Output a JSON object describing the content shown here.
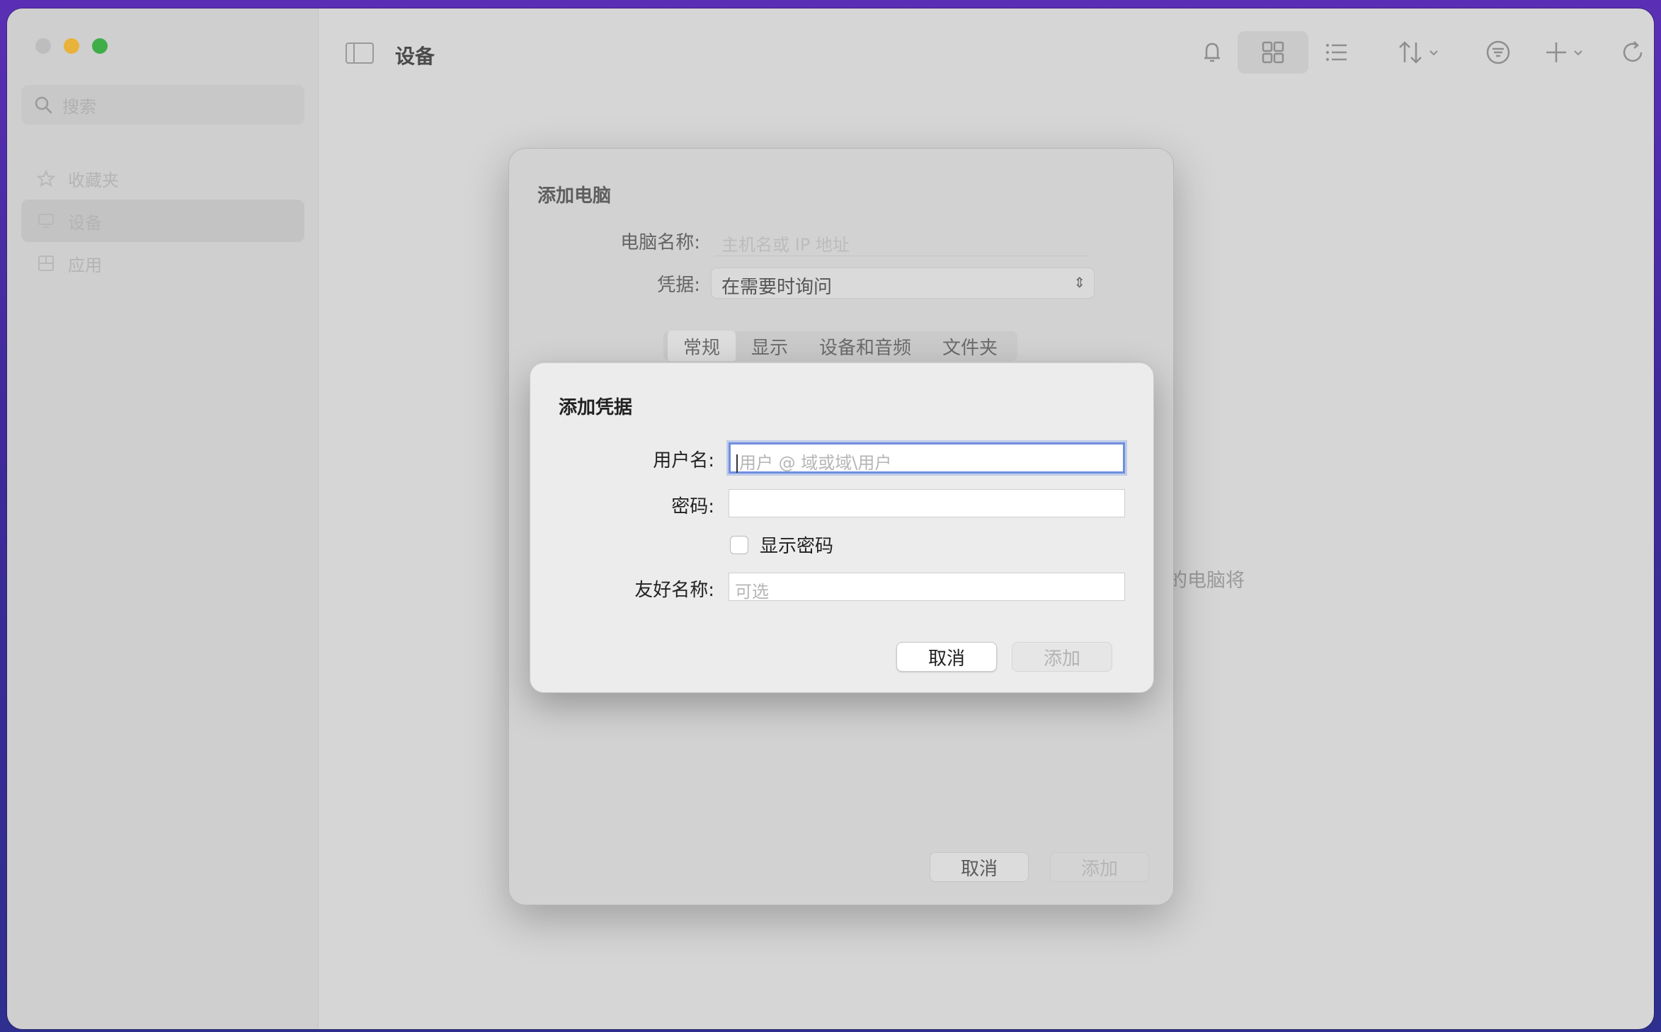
{
  "window": {
    "title": "设备"
  },
  "sidebar": {
    "search_placeholder": "搜索",
    "items": [
      {
        "label": "收藏夹",
        "icon": "star-icon"
      },
      {
        "label": "设备",
        "icon": "display-icon",
        "selected": true
      },
      {
        "label": "应用",
        "icon": "apps-icon"
      }
    ]
  },
  "toolbar": {
    "icons": [
      "bell-icon",
      "grid-view-icon",
      "list-view-icon",
      "sort-icon",
      "filter-icon",
      "add-icon",
      "refresh-icon"
    ]
  },
  "background": {
    "partial_text": "的电脑将"
  },
  "add_pc_dialog": {
    "title": "添加电脑",
    "pc_name_label": "电脑名称:",
    "pc_name_placeholder": "主机名或 IP 地址",
    "credentials_label": "凭据:",
    "credentials_value": "在需要时询问",
    "tabs": [
      "常规",
      "显示",
      "设备和音频",
      "文件夹"
    ],
    "active_tab": "常规",
    "cancel": "取消",
    "add": "添加"
  },
  "add_credential_dialog": {
    "title": "添加凭据",
    "username_label": "用户名:",
    "username_placeholder": "用户 @ 域或域\\用户",
    "password_label": "密码:",
    "show_password_label": "显示密码",
    "friendly_name_label": "友好名称:",
    "friendly_name_placeholder": "可选",
    "cancel": "取消",
    "add": "添加"
  }
}
